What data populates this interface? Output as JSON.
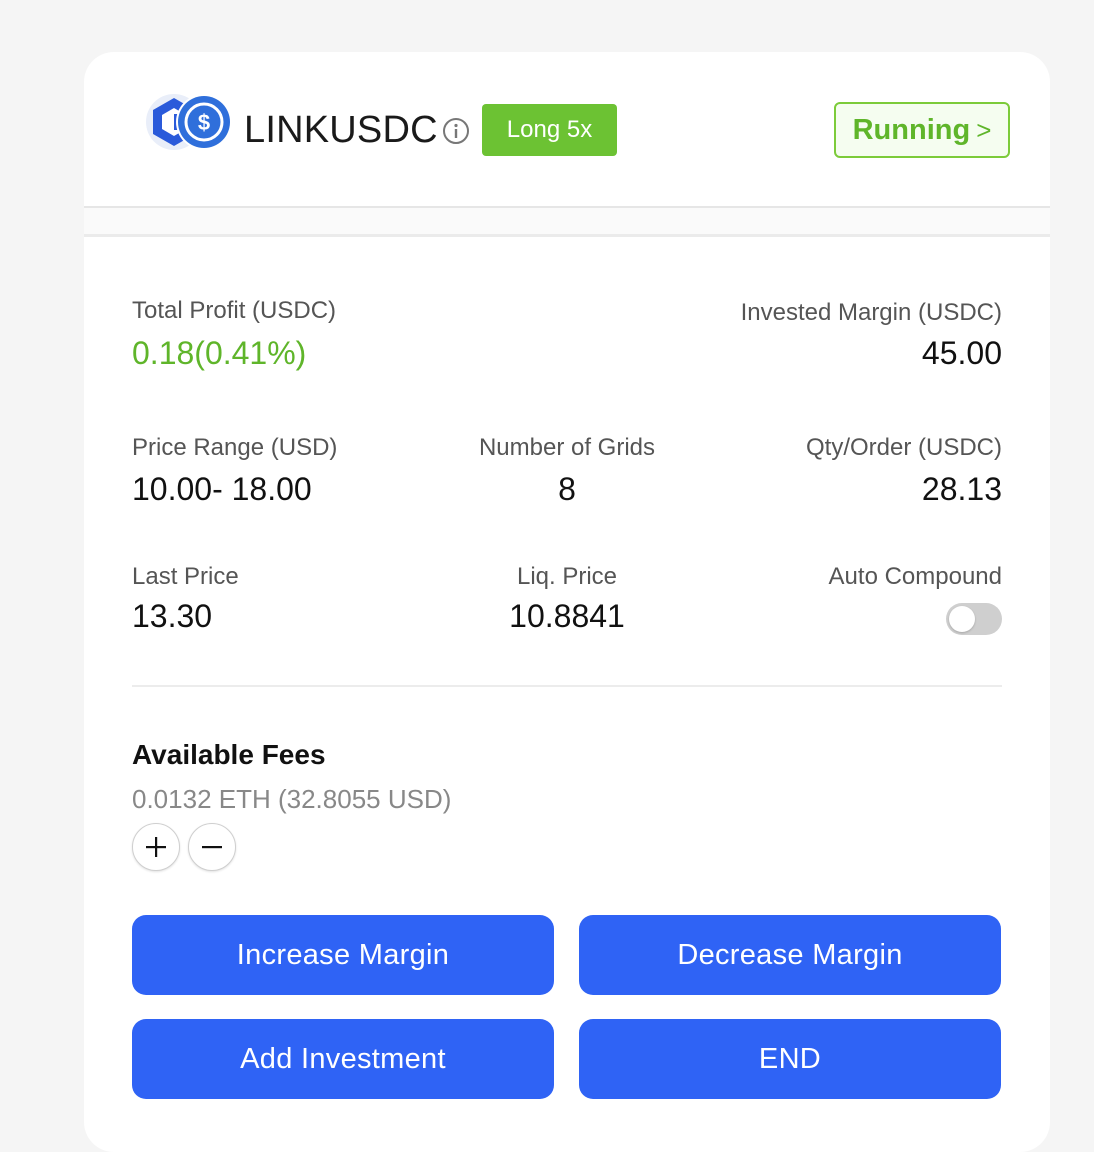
{
  "header": {
    "pair": "LINKUSDC",
    "position_badge": "Long 5x",
    "status": "Running",
    "status_chevron": ">"
  },
  "stats": {
    "total_profit_label": "Total Profit (USDC)",
    "total_profit_value": "0.18(0.41%)",
    "invested_margin_label": "Invested Margin (USDC)",
    "invested_margin_value": "45.00",
    "price_range_label": "Price Range (USD)",
    "price_range_value": "10.00- 18.00",
    "grids_label": "Number of Grids",
    "grids_value": "8",
    "qty_order_label": "Qty/Order (USDC)",
    "qty_order_value": "28.13",
    "last_price_label": "Last Price",
    "last_price_value": "13.30",
    "liq_price_label": "Liq. Price",
    "liq_price_value": "10.8841",
    "auto_compound_label": "Auto Compound"
  },
  "auto_compound_on": false,
  "fees": {
    "title": "Available Fees",
    "value": "0.0132 ETH (32.8055 USD)"
  },
  "actions": {
    "increase_margin": "Increase Margin",
    "decrease_margin": "Decrease Margin",
    "add_investment": "Add Investment",
    "end": "END"
  },
  "colors": {
    "accent_green": "#6cc233",
    "primary_blue": "#2f63f5",
    "coin_blue": "#2f6fdb"
  },
  "icons": {
    "logo": "link-usdc-pair-logo",
    "info": "info-icon",
    "plus": "plus-icon",
    "minus": "minus-icon"
  }
}
